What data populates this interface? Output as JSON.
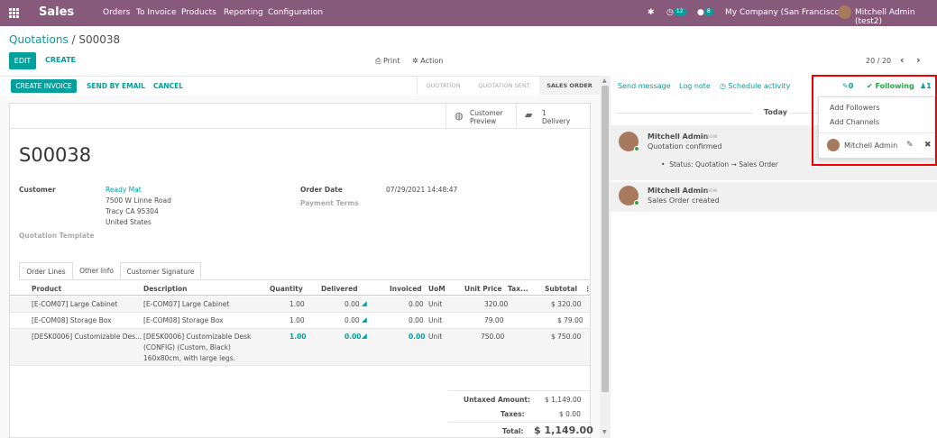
{
  "nav": {
    "brand": "Sales",
    "menu": [
      "Orders",
      "To Invoice",
      "Products",
      "Reporting",
      "Configuration"
    ],
    "activity_count": "12",
    "messages_count": "8",
    "company": "My Company (San Francisco)",
    "user": "Mitchell Admin (test2)"
  },
  "breadcrumb": {
    "parent": "Quotations",
    "sep": " / ",
    "current": "S00038"
  },
  "control": {
    "edit": "EDIT",
    "create": "CREATE",
    "print": "Print",
    "action": "Action",
    "pager": "20 / 20"
  },
  "statusbar": {
    "create_invoice": "CREATE INVOICE",
    "send_email": "SEND BY EMAIL",
    "cancel": "CANCEL",
    "stages": [
      "QUOTATION",
      "QUOTATION SENT",
      "SALES ORDER"
    ]
  },
  "smart_buttons": {
    "preview_line1": "Customer",
    "preview_line2": "Preview",
    "delivery_count": "1",
    "delivery_label": "Delivery"
  },
  "order": {
    "name": "S00038",
    "customer_label": "Customer",
    "customer_name": "Ready Mat",
    "address1": "7500 W Linne Road",
    "address2": "Tracy CA 95304",
    "address3": "United States",
    "template_label": "Quotation Template",
    "date_label": "Order Date",
    "date_value": "07/29/2021 14:48:47",
    "terms_label": "Payment Terms"
  },
  "tabs": [
    "Order Lines",
    "Other Info",
    "Customer Signature"
  ],
  "columns": [
    "Product",
    "Description",
    "Quantity",
    "Delivered",
    "Invoiced",
    "UoM",
    "Unit Price",
    "Tax...",
    "Subtotal"
  ],
  "lines": [
    {
      "product": "[E-COM07] Large Cabinet",
      "desc1": "[E-COM07] Large Cabinet",
      "desc2": "",
      "desc3": "",
      "qty": "1.00",
      "delivered": "0.00",
      "invoiced": "0.00",
      "uom": "Unit",
      "price": "320.00",
      "subtotal": "$ 320.00"
    },
    {
      "product": "[E-COM08] Storage Box",
      "desc1": "[E-COM08] Storage Box",
      "desc2": "",
      "desc3": "",
      "qty": "1.00",
      "delivered": "0.00",
      "invoiced": "0.00",
      "uom": "Unit",
      "price": "79.00",
      "subtotal": "$ 79.00"
    },
    {
      "product": "[DESK0006] Customizable Des...",
      "desc1": "[DESK0006] Customizable Desk",
      "desc2": "(CONFIG) (Custom, Black)",
      "desc3": "160x80cm, with large legs.",
      "qty": "1.00",
      "delivered": "0.00",
      "invoiced": "0.00",
      "uom": "Unit",
      "price": "750.00",
      "subtotal": "$ 750.00"
    }
  ],
  "totals": {
    "untaxed_label": "Untaxed Amount:",
    "untaxed": "$ 1,149.00",
    "taxes_label": "Taxes:",
    "taxes": "$ 0.00",
    "total_label": "Total:",
    "total": "$ 1,149.00"
  },
  "chatter": {
    "send_message": "Send message",
    "log_note": "Log note",
    "schedule": "Schedule activity",
    "attachments": "0",
    "following": "Following",
    "followers": "1",
    "today": "Today",
    "msg1_author": "Mitchell Admin",
    "msg1_time": "- now",
    "msg1_body": "Quotation confirmed",
    "msg1_status": "Status: Quotation → Sales Order",
    "msg2_author": "Mitchell Admin",
    "msg2_time": "- now",
    "msg2_body": "Sales Order created"
  },
  "followers_popup": {
    "add_followers": "Add Followers",
    "add_channels": "Add Channels",
    "follower_name": "Mitchell Admin"
  }
}
